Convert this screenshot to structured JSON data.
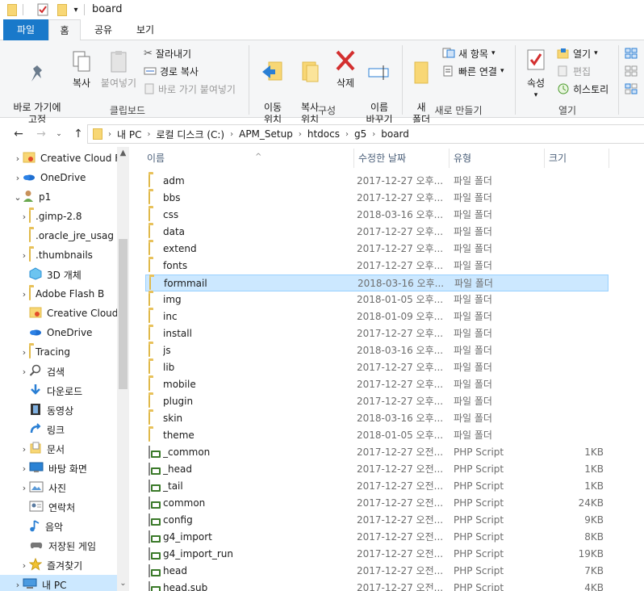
{
  "window": {
    "title": "board"
  },
  "ribbon_tabs": [
    "파일",
    "홈",
    "공유",
    "보기"
  ],
  "ribbon": {
    "clipboard": {
      "pin_label": "바로 가기에\n고정",
      "copy_label": "복사",
      "paste_label": "붙여넣기",
      "cut_label": "잘라내기",
      "copy_path_label": "경로 복사",
      "paste_shortcut_label": "바로 가기 붙여넣기",
      "group_label": "클립보드"
    },
    "organize": {
      "move_label": "이동\n위치",
      "copy_to_label": "복사\n위치",
      "delete_label": "삭제",
      "rename_label": "이름\n바꾸기",
      "group_label": "구성"
    },
    "new": {
      "new_folder_label": "새\n폴더",
      "new_item_label": "새 항목",
      "easy_access_label": "빠른 연결",
      "group_label": "새로 만들기"
    },
    "open": {
      "properties_label": "속성",
      "open_label": "열기",
      "edit_label": "편집",
      "history_label": "히스토리",
      "group_label": "열기"
    }
  },
  "address": {
    "crumbs": [
      "내 PC",
      "로컬 디스크 (C:)",
      "APM_Setup",
      "htdocs",
      "g5",
      "board"
    ]
  },
  "nav_tree": [
    {
      "label": "Creative Cloud F",
      "icon": "creative-cloud-icon",
      "chev": "›",
      "indent": 1
    },
    {
      "label": "OneDrive",
      "icon": "onedrive-icon",
      "chev": "›",
      "indent": 1
    },
    {
      "label": "p1",
      "icon": "user-icon",
      "chev": "⌄",
      "indent": 1
    },
    {
      "label": ".gimp-2.8",
      "icon": "folder-icon",
      "chev": "›",
      "indent": 2
    },
    {
      "label": ".oracle_jre_usag",
      "icon": "folder-icon",
      "chev": "",
      "indent": 2
    },
    {
      "label": ".thumbnails",
      "icon": "folder-icon",
      "chev": "›",
      "indent": 2
    },
    {
      "label": "3D 개체",
      "icon": "3d-objects-icon",
      "chev": "",
      "indent": 2
    },
    {
      "label": "Adobe Flash B",
      "icon": "folder-icon",
      "chev": "›",
      "indent": 2
    },
    {
      "label": "Creative Cloud",
      "icon": "creative-cloud-icon",
      "chev": "",
      "indent": 2
    },
    {
      "label": "OneDrive",
      "icon": "onedrive-icon",
      "chev": "",
      "indent": 2
    },
    {
      "label": "Tracing",
      "icon": "folder-icon",
      "chev": "›",
      "indent": 2
    },
    {
      "label": "검색",
      "icon": "search-icon",
      "chev": "›",
      "indent": 2
    },
    {
      "label": "다운로드",
      "icon": "download-icon",
      "chev": "",
      "indent": 2
    },
    {
      "label": "동영상",
      "icon": "video-icon",
      "chev": "",
      "indent": 2
    },
    {
      "label": "링크",
      "icon": "link-icon",
      "chev": "",
      "indent": 2
    },
    {
      "label": "문서",
      "icon": "documents-icon",
      "chev": "›",
      "indent": 2
    },
    {
      "label": "바탕 화면",
      "icon": "desktop-icon",
      "chev": "›",
      "indent": 2
    },
    {
      "label": "사진",
      "icon": "pictures-icon",
      "chev": "›",
      "indent": 2
    },
    {
      "label": "연락처",
      "icon": "contacts-icon",
      "chev": "",
      "indent": 2
    },
    {
      "label": "음악",
      "icon": "music-icon",
      "chev": "",
      "indent": 2
    },
    {
      "label": "저장된 게임",
      "icon": "saved-games-icon",
      "chev": "",
      "indent": 2
    },
    {
      "label": "즐겨찾기",
      "icon": "favorites-icon",
      "chev": "›",
      "indent": 2
    },
    {
      "label": "내 PC",
      "icon": "this-pc-icon",
      "chev": "›",
      "indent": 1
    }
  ],
  "columns": {
    "name": "이름",
    "date": "수정한 날짜",
    "type": "유형",
    "size": "크기"
  },
  "files": [
    {
      "name": "adm",
      "date": "2017-12-27 오후...",
      "type": "파일 폴더",
      "size": "",
      "kind": "folder"
    },
    {
      "name": "bbs",
      "date": "2017-12-27 오후...",
      "type": "파일 폴더",
      "size": "",
      "kind": "folder"
    },
    {
      "name": "css",
      "date": "2018-03-16 오후...",
      "type": "파일 폴더",
      "size": "",
      "kind": "folder"
    },
    {
      "name": "data",
      "date": "2017-12-27 오후...",
      "type": "파일 폴더",
      "size": "",
      "kind": "folder"
    },
    {
      "name": "extend",
      "date": "2017-12-27 오후...",
      "type": "파일 폴더",
      "size": "",
      "kind": "folder"
    },
    {
      "name": "fonts",
      "date": "2017-12-27 오후...",
      "type": "파일 폴더",
      "size": "",
      "kind": "folder"
    },
    {
      "name": "formmail",
      "date": "2018-03-16 오후...",
      "type": "파일 폴더",
      "size": "",
      "kind": "folder",
      "selected": true
    },
    {
      "name": "img",
      "date": "2018-01-05 오후...",
      "type": "파일 폴더",
      "size": "",
      "kind": "folder"
    },
    {
      "name": "inc",
      "date": "2018-01-09 오후...",
      "type": "파일 폴더",
      "size": "",
      "kind": "folder"
    },
    {
      "name": "install",
      "date": "2017-12-27 오후...",
      "type": "파일 폴더",
      "size": "",
      "kind": "folder"
    },
    {
      "name": "js",
      "date": "2018-03-16 오후...",
      "type": "파일 폴더",
      "size": "",
      "kind": "folder"
    },
    {
      "name": "lib",
      "date": "2017-12-27 오후...",
      "type": "파일 폴더",
      "size": "",
      "kind": "folder"
    },
    {
      "name": "mobile",
      "date": "2017-12-27 오후...",
      "type": "파일 폴더",
      "size": "",
      "kind": "folder"
    },
    {
      "name": "plugin",
      "date": "2017-12-27 오후...",
      "type": "파일 폴더",
      "size": "",
      "kind": "folder"
    },
    {
      "name": "skin",
      "date": "2018-03-16 오후...",
      "type": "파일 폴더",
      "size": "",
      "kind": "folder"
    },
    {
      "name": "theme",
      "date": "2018-01-05 오후...",
      "type": "파일 폴더",
      "size": "",
      "kind": "folder"
    },
    {
      "name": "_common",
      "date": "2017-12-27 오전...",
      "type": "PHP Script",
      "size": "1KB",
      "kind": "php"
    },
    {
      "name": "_head",
      "date": "2017-12-27 오전...",
      "type": "PHP Script",
      "size": "1KB",
      "kind": "php"
    },
    {
      "name": "_tail",
      "date": "2017-12-27 오전...",
      "type": "PHP Script",
      "size": "1KB",
      "kind": "php"
    },
    {
      "name": "common",
      "date": "2017-12-27 오전...",
      "type": "PHP Script",
      "size": "24KB",
      "kind": "php"
    },
    {
      "name": "config",
      "date": "2017-12-27 오전...",
      "type": "PHP Script",
      "size": "9KB",
      "kind": "php"
    },
    {
      "name": "g4_import",
      "date": "2017-12-27 오전...",
      "type": "PHP Script",
      "size": "8KB",
      "kind": "php"
    },
    {
      "name": "g4_import_run",
      "date": "2017-12-27 오전...",
      "type": "PHP Script",
      "size": "19KB",
      "kind": "php"
    },
    {
      "name": "head",
      "date": "2017-12-27 오전...",
      "type": "PHP Script",
      "size": "7KB",
      "kind": "php"
    },
    {
      "name": "head.sub",
      "date": "2017-12-27 오전...",
      "type": "PHP Script",
      "size": "4KB",
      "kind": "php"
    }
  ],
  "colors": {
    "file_tab": "#1979ca",
    "selection": "#cce8ff",
    "selection_border": "#99d1ff",
    "folder": "#f8d775",
    "delete_red": "#d32f2f"
  }
}
